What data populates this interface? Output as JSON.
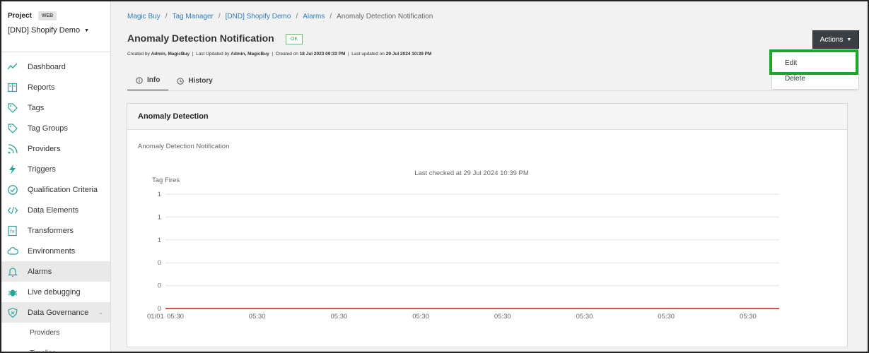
{
  "sidebar": {
    "project_label": "Project",
    "project_badge": "WEB",
    "project_name": "[DND] Shopify Demo",
    "items": [
      {
        "label": "Dashboard",
        "icon": "dashboard-icon"
      },
      {
        "label": "Reports",
        "icon": "reports-icon"
      },
      {
        "label": "Tags",
        "icon": "tag-icon"
      },
      {
        "label": "Tag Groups",
        "icon": "tag-groups-icon"
      },
      {
        "label": "Providers",
        "icon": "rss-icon"
      },
      {
        "label": "Triggers",
        "icon": "lightning-icon"
      },
      {
        "label": "Qualification Criteria",
        "icon": "check-circle-icon"
      },
      {
        "label": "Data Elements",
        "icon": "code-icon"
      },
      {
        "label": "Transformers",
        "icon": "transform-icon"
      },
      {
        "label": "Environments",
        "icon": "cloud-icon"
      },
      {
        "label": "Alarms",
        "icon": "bell-icon"
      },
      {
        "label": "Live debugging",
        "icon": "bug-icon"
      },
      {
        "label": "Data Governance",
        "icon": "shield-icon"
      }
    ],
    "sub_items": [
      "Providers",
      "Timeline"
    ]
  },
  "breadcrumb": {
    "items": [
      "Magic Buy",
      "Tag Manager",
      "[DND] Shopify Demo",
      "Alarms"
    ],
    "current": "Anomaly Detection Notification",
    "sep": "/"
  },
  "page": {
    "title": "Anomaly Detection Notification",
    "status": "OK",
    "meta": {
      "created_by_label": "Created by",
      "created_by": "Admin, MagicBuy",
      "updated_by_label": "Last Updated by",
      "updated_by": "Admin, MagicBuy",
      "created_on_label": "Created on",
      "created_on": "18 Jul 2023 09:33 PM",
      "updated_on_label": "Last updated on",
      "updated_on": "29 Jul 2024 10:39 PM"
    }
  },
  "tabs": [
    {
      "label": "Info",
      "icon": "info-icon"
    },
    {
      "label": "History",
      "icon": "clock-icon"
    }
  ],
  "actions": {
    "button_label": "Actions",
    "menu": [
      "Edit",
      "Delete"
    ]
  },
  "card": {
    "title": "Anomaly Detection",
    "subtitle": "Anomaly Detection Notification"
  },
  "chart_data": {
    "type": "line",
    "title": "Last checked at 29 Jul 2024 10:39 PM",
    "ylabel": "Tag Fires",
    "ytick_labels": [
      "1",
      "1",
      "1",
      "0",
      "0",
      "0"
    ],
    "x_first_label": "01/01",
    "xtick_labels": [
      "05:30",
      "05:30",
      "05:30",
      "05:30",
      "05:30",
      "05:30",
      "05:30",
      "05:30"
    ],
    "series": [
      {
        "values": [
          0,
          0,
          0,
          0,
          0,
          0,
          0,
          0
        ],
        "color": "#d9342b"
      }
    ],
    "grid": true
  }
}
